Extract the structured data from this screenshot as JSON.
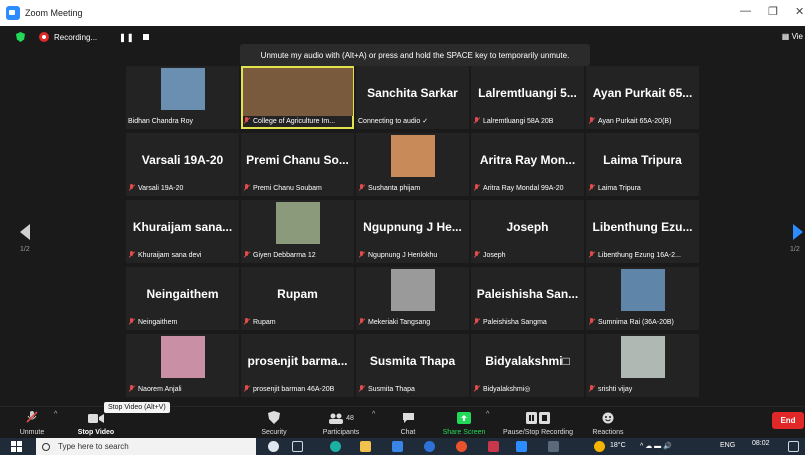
{
  "window": {
    "title": "Zoom Meeting",
    "minimize": "—",
    "maximize": "❐",
    "close": "✕"
  },
  "topbar": {
    "recording_label": "Recording...",
    "pause_glyph": "❚❚",
    "view_label": "Vie"
  },
  "banner": "Unmute my audio with (Alt+A) or press and hold the SPACE key to temporarily unmute.",
  "tiles": [
    {
      "big": "",
      "footer": "Bidhan Chandra Roy",
      "photo": true,
      "muted": false,
      "speaking": false,
      "photo_color": "#6b8fb0"
    },
    {
      "big": "",
      "footer": "College of Agriculture Im...",
      "photo": true,
      "muted": true,
      "speaking": true,
      "photo_color": "#7a5a3c"
    },
    {
      "big": "Sanchita Sarkar",
      "footer": "Connecting to audio ✓",
      "photo": false,
      "muted": false,
      "speaking": false
    },
    {
      "big": "Lalremtluangi 5...",
      "footer": "Lalremtluangi 58A 20B",
      "photo": false,
      "muted": true,
      "speaking": false
    },
    {
      "big": "Ayan Purkait 65...",
      "footer": "Ayan Purkait 65A-20(B)",
      "photo": false,
      "muted": true,
      "speaking": false
    },
    {
      "big": "Varsali 19A-20",
      "footer": "Varsali 19A-20",
      "photo": false,
      "muted": true,
      "speaking": false
    },
    {
      "big": "Premi Chanu So...",
      "footer": "Premi Chanu Soubam",
      "photo": false,
      "muted": true,
      "speaking": false
    },
    {
      "big": "",
      "footer": "Sushanta phijam",
      "photo": true,
      "muted": true,
      "speaking": false,
      "photo_color": "#c98a5a"
    },
    {
      "big": "Aritra Ray Mon...",
      "footer": "Aritra Ray Mondal 99A-20",
      "photo": false,
      "muted": true,
      "speaking": false
    },
    {
      "big": "Laima Tripura",
      "footer": "Laima Tripura",
      "photo": false,
      "muted": true,
      "speaking": false
    },
    {
      "big": "Khuraijam sana...",
      "footer": "Khuraijam sana devi",
      "photo": false,
      "muted": true,
      "speaking": false
    },
    {
      "big": "",
      "footer": "Giyen Debbarma 12",
      "photo": true,
      "muted": true,
      "speaking": false,
      "photo_color": "#8a9a7a"
    },
    {
      "big": "Ngupnung J He...",
      "footer": "Ngupnung J Henlokhu",
      "photo": false,
      "muted": true,
      "speaking": false
    },
    {
      "big": "Joseph",
      "footer": "Joseph",
      "photo": false,
      "muted": true,
      "speaking": false
    },
    {
      "big": "Libenthung Ezu...",
      "footer": "Libenthung Ezung 16A-2...",
      "photo": false,
      "muted": true,
      "speaking": false
    },
    {
      "big": "Neingaithem",
      "footer": "Neingaithem",
      "photo": false,
      "muted": true,
      "speaking": false
    },
    {
      "big": "Rupam",
      "footer": "Rupam",
      "photo": false,
      "muted": true,
      "speaking": false
    },
    {
      "big": "",
      "footer": "Mekeriaki Tangsang",
      "photo": true,
      "muted": true,
      "speaking": false,
      "photo_color": "#9a9a9a"
    },
    {
      "big": "Paleishisha San...",
      "footer": "Paleishisha Sangma",
      "photo": false,
      "muted": true,
      "speaking": false
    },
    {
      "big": "",
      "footer": "Sumnima Rai (36A-20B)",
      "photo": true,
      "muted": true,
      "speaking": false,
      "photo_color": "#5f86a8"
    },
    {
      "big": "",
      "footer": "Naorem Anjali",
      "photo": true,
      "muted": true,
      "speaking": false,
      "photo_color": "#c98fa5"
    },
    {
      "big": "prosenjit barma...",
      "footer": "prosenjit barman 46A-20B",
      "photo": false,
      "muted": true,
      "speaking": false
    },
    {
      "big": "Susmita Thapa",
      "footer": "Susmita Thapa",
      "photo": false,
      "muted": true,
      "speaking": false
    },
    {
      "big": "Bidyalakshmi□",
      "footer": "Bidyalakshmi◎",
      "photo": false,
      "muted": true,
      "speaking": false
    },
    {
      "big": "",
      "footer": "srishti vijay",
      "photo": true,
      "muted": true,
      "speaking": false,
      "photo_color": "#b0b8b4"
    }
  ],
  "pager": {
    "left": "1/2",
    "right": "1/2"
  },
  "toolbar": {
    "unmute": "Unmute",
    "stop_video": "Stop Video",
    "tooltip": "Stop Video (Alt+V)",
    "security": "Security",
    "participants": "Participants",
    "participants_count": "48",
    "chat": "Chat",
    "share_screen": "Share Screen",
    "pause_recording": "Pause/Stop Recording",
    "reactions": "Reactions",
    "end": "End"
  },
  "taskbar": {
    "search_placeholder": "Type here to search",
    "weather": "18°C",
    "lang": "ENG",
    "time": "08:02"
  }
}
